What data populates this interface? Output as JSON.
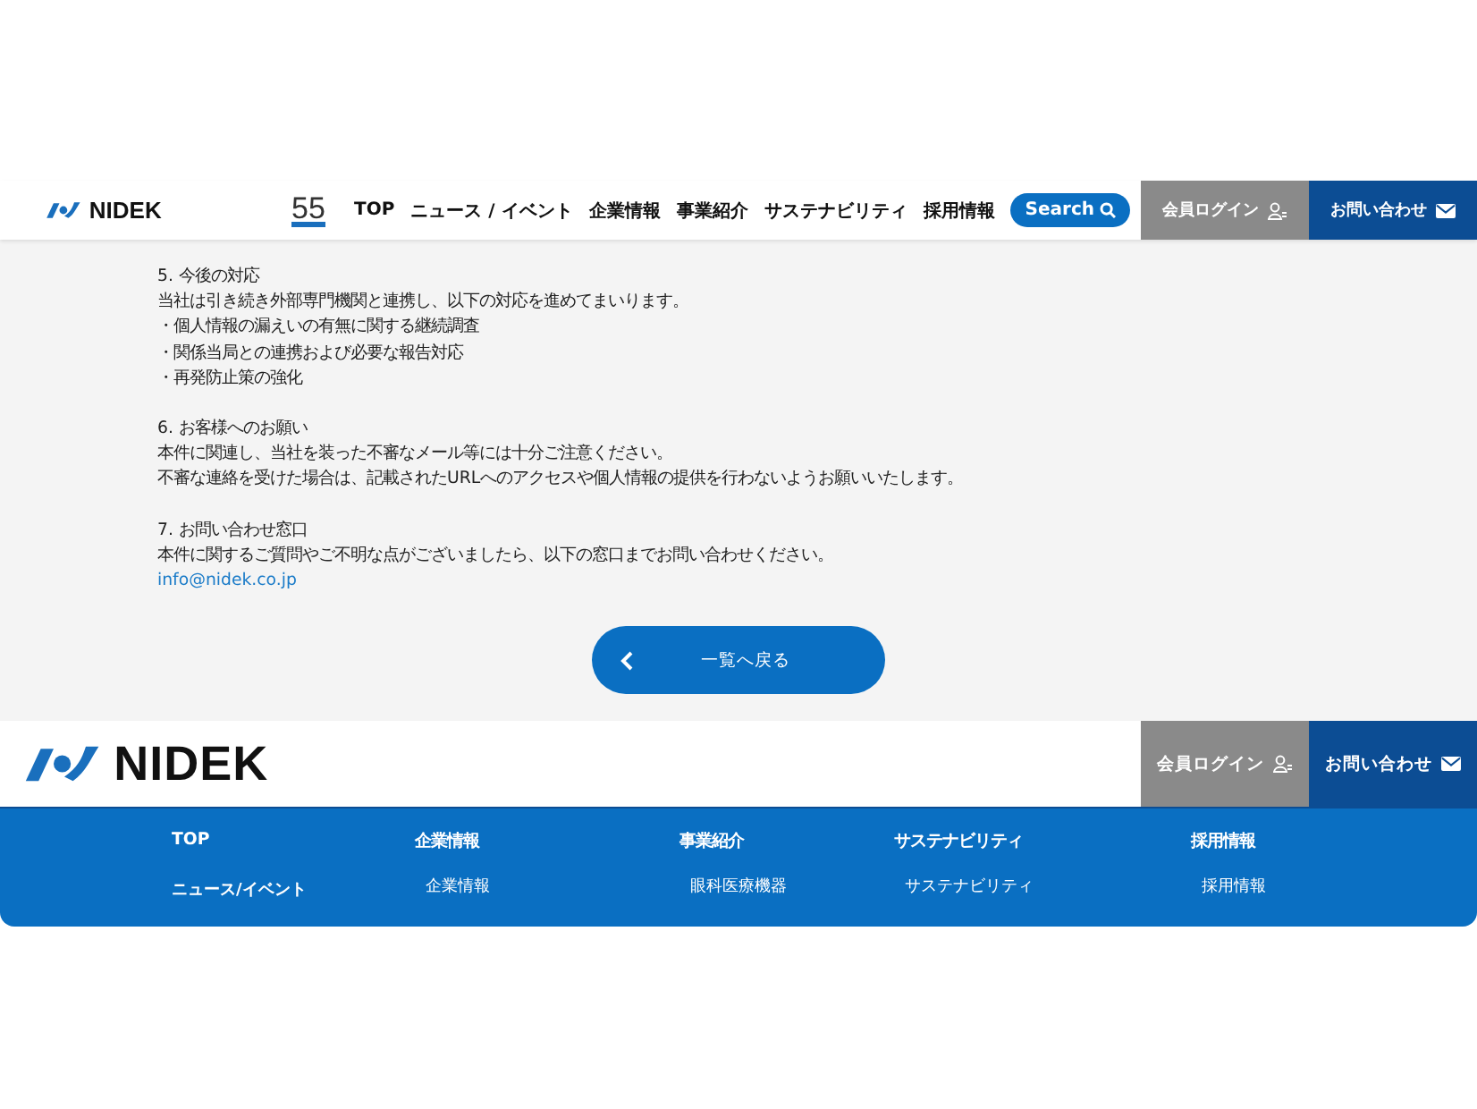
{
  "header": {
    "brand": "NIDEK",
    "anniversary": "55",
    "nav": [
      "TOP",
      "ニュース / イベント",
      "企業情報",
      "事業紹介",
      "サステナビリティ",
      "採用情報"
    ],
    "search": "Search",
    "login": "会員ログイン",
    "contact": "お問い合わせ"
  },
  "sections": [
    {
      "heading": "5. 今後の対応",
      "lines": [
        "当社は引き続き外部専門機関と連携し、以下の対応を進めてまいります。",
        "・個人情報の漏えいの有無に関する継続調査",
        "・関係当局との連携および必要な報告対応",
        "・再発防止策の強化"
      ]
    },
    {
      "heading": "6. お客様へのお願い",
      "lines": [
        "本件に関連し、当社を装った不審なメール等には十分ご注意ください。",
        "不審な連絡を受けた場合は、記載されたURLへのアクセスや個人情報の提供を行わないようお願いいたします。"
      ]
    },
    {
      "heading": "7. お問い合わせ窓口",
      "lines": [
        "本件に関するご質問やご不明な点がございましたら、以下の窓口までお問い合わせください。"
      ],
      "link": "info@nidek.co.jp"
    }
  ],
  "back_button": "一覧へ戻る",
  "footer": {
    "brand": "NIDEK",
    "login": "会員ログイン",
    "contact": "お問い合わせ",
    "columns": [
      {
        "heading": "TOP",
        "items": [
          "ニュース/イベント"
        ],
        "kind": "bold"
      },
      {
        "heading": "企業情報",
        "items": [
          "企業情報"
        ],
        "kind": "plain"
      },
      {
        "heading": "事業紹介",
        "items": [
          "眼科医療機器"
        ],
        "kind": "plain"
      },
      {
        "heading": "サステナビリティ",
        "items": [
          "サステナビリティ"
        ],
        "kind": "plain"
      },
      {
        "heading": "採用情報",
        "items": [
          "採用情報"
        ],
        "kind": "plain"
      }
    ]
  }
}
